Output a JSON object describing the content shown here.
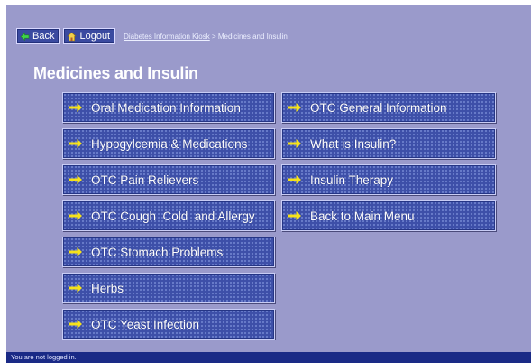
{
  "toolbar": {
    "back_label": "Back",
    "logout_label": "Logout",
    "breadcrumb_link": "Diabetes Information Kiosk",
    "breadcrumb_sep": " > ",
    "breadcrumb_current": "Medicines and Insulin"
  },
  "page": {
    "title": "Medicines and Insulin"
  },
  "menu": {
    "left": [
      {
        "label": "Oral Medication Information"
      },
      {
        "label": "Hypogylcemia & Medications"
      },
      {
        "label": "OTC Pain Relievers"
      },
      {
        "label": "OTC Cough  Cold  and Allergy"
      },
      {
        "label": "OTC Stomach Problems"
      },
      {
        "label": "Herbs"
      },
      {
        "label": "OTC Yeast Infection"
      }
    ],
    "right": [
      {
        "label": "OTC General Information"
      },
      {
        "label": "What is Insulin?"
      },
      {
        "label": "Insulin Therapy"
      },
      {
        "label": "Back to Main Menu"
      }
    ]
  },
  "status": {
    "text": "You are not logged in."
  },
  "colors": {
    "background": "#9a9acb",
    "button": "#3d4fa8",
    "arrow": "#f6e21a",
    "status_bar": "#1a2a86"
  },
  "icons": {
    "back": "left-arrow-icon",
    "logout": "home-icon",
    "menu": "right-arrow-icon"
  }
}
